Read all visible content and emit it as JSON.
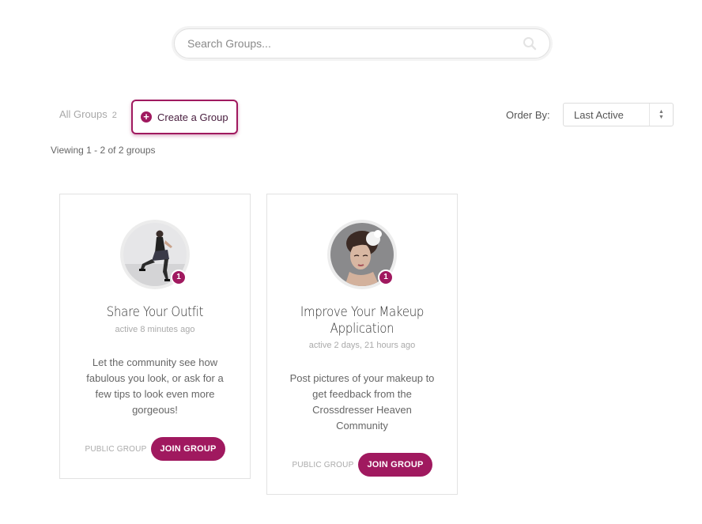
{
  "search": {
    "placeholder": "Search Groups..."
  },
  "tabs": {
    "all_groups_label": "All Groups",
    "all_groups_count": "2",
    "create_label": "Create a Group"
  },
  "order": {
    "label": "Order By:",
    "selected": "Last Active"
  },
  "viewing_text": "Viewing 1 - 2 of 2 groups",
  "colors": {
    "accent": "#a0195f"
  },
  "groups": [
    {
      "title": "Share Your Outfit",
      "active": "active 8 minutes ago",
      "description": "Let the community see how fabulous you look, or ask for a few tips to look even more gorgeous!",
      "member_count": "1",
      "type": "PUBLIC GROUP",
      "join_label": "JOIN GROUP"
    },
    {
      "title": "Improve Your Makeup Application",
      "active": "active 2 days, 21 hours ago",
      "description": "Post pictures of your makeup to get feedback from the Crossdresser Heaven Community",
      "member_count": "1",
      "type": "PUBLIC GROUP",
      "join_label": "JOIN GROUP"
    }
  ]
}
